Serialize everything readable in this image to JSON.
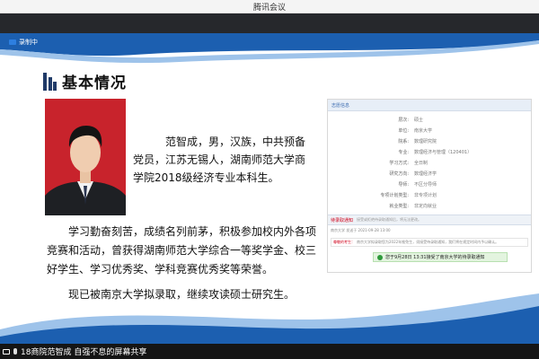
{
  "window": {
    "title": "腾讯会议"
  },
  "recording": {
    "label": "录制中"
  },
  "slide": {
    "heading": "基本情况",
    "intro_lines": [
      "范智成，男，汉族，中共预备",
      "党员，江苏无锡人，湖南师范大学商",
      "学院2018级经济专业本科生。"
    ],
    "para1_lines": [
      "学习勤奋刻苦，成绩名列前茅，积极参加校内外各项",
      "竞赛和活动，曾获得湖南师范大学综合一等奖学金、校三",
      "好学生、学习优秀奖、学科竞赛优秀奖等荣誉。"
    ],
    "para2_lines": [
      "现已被南京大学拟录取，继续攻读硕士研究生。"
    ]
  },
  "document": {
    "header": "志愿信息",
    "rows": [
      {
        "label": "层次:",
        "value": "硕士"
      },
      {
        "label": "单位:",
        "value": "南京大学"
      },
      {
        "label": "院系:",
        "value": "数理研究院"
      },
      {
        "label": "专业:",
        "value": "数理经济与管理（120401）"
      },
      {
        "label": "学习方式:",
        "value": "全日制"
      },
      {
        "label": "研究方向:",
        "value": "数理经济学"
      },
      {
        "label": "导师:",
        "value": "不区分导师"
      },
      {
        "label": "专项计划类型:",
        "value": "非专项计划"
      },
      {
        "label": "就业类型:",
        "value": "非定向就业"
      }
    ],
    "section_label": "待录取通知",
    "section_note": "接受或拒绝待录取通知后，将无法更改。",
    "meta": "南京大学 发送于 2021-09-28 13:00",
    "message_lead": "尊敬的考生：",
    "message": "南京大学拟录取您为2022年推免生，须接受待录取通知，我们将在规定时间内予以确认。",
    "accept_text": "您于9月28日 13:31接受了南京大学的待录取通知"
  },
  "bottom": {
    "share_text": "18商院范智成 自强不息的屏幕共享"
  },
  "colors": {
    "heading_bar": "#1f3a68",
    "wave": "#1c5fb0",
    "photo_bg": "#c8232c",
    "accept_bg": "#e3f4df"
  }
}
